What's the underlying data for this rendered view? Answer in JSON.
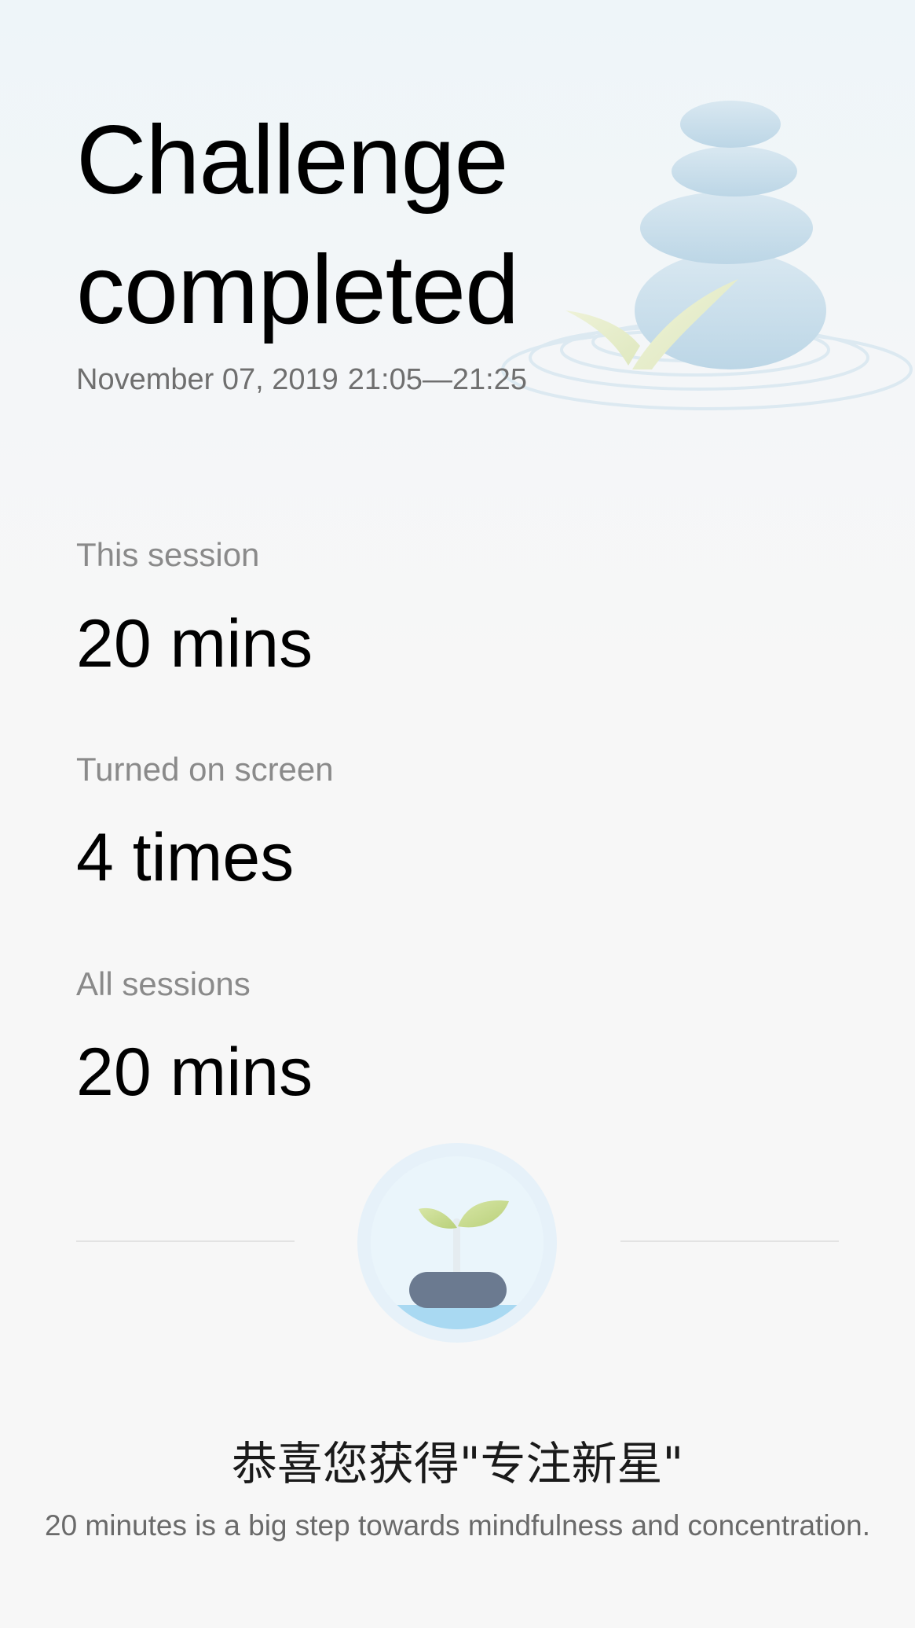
{
  "header": {
    "title_line1": "Challenge",
    "title_line2": "completed",
    "date": "November 07, 2019",
    "time_range": "21:05—21:25"
  },
  "stats": [
    {
      "label": "This session",
      "value": "20 mins"
    },
    {
      "label": "Turned on screen",
      "value": "4 times"
    },
    {
      "label": "All sessions",
      "value": "20 mins"
    }
  ],
  "award": {
    "title": "恭喜您获得\"专注新星\"",
    "description": "20 minutes is a big step towards mindfulness and concentration.",
    "badge_icon": "sprout-badge-icon"
  },
  "illustration": {
    "name": "stacked-stones-illustration"
  }
}
